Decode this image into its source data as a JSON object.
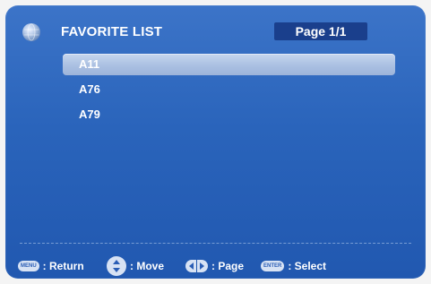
{
  "header": {
    "title": "FAVORITE LIST",
    "page_indicator": "Page 1/1"
  },
  "list": {
    "items": [
      {
        "label": "A11",
        "selected": true
      },
      {
        "label": "A76",
        "selected": false
      },
      {
        "label": "A79",
        "selected": false
      }
    ]
  },
  "footer": {
    "menu_key": "MENU",
    "return_label": ": Return",
    "move_label": ": Move",
    "page_label": ": Page",
    "enter_key": "ENTER",
    "select_label": ": Select"
  },
  "colors": {
    "panel_background": "#2a64bb",
    "page_box_background": "#1a3f8c",
    "selected_row_background": "#aac0e2",
    "text": "#ffffff"
  },
  "icons": {
    "header_icon": "globe-icon",
    "menu_key_icon": "menu-key-icon",
    "move_icon": "up-down-arrows-icon",
    "page_icon": "left-right-arrows-icon",
    "enter_key_icon": "enter-key-icon"
  }
}
